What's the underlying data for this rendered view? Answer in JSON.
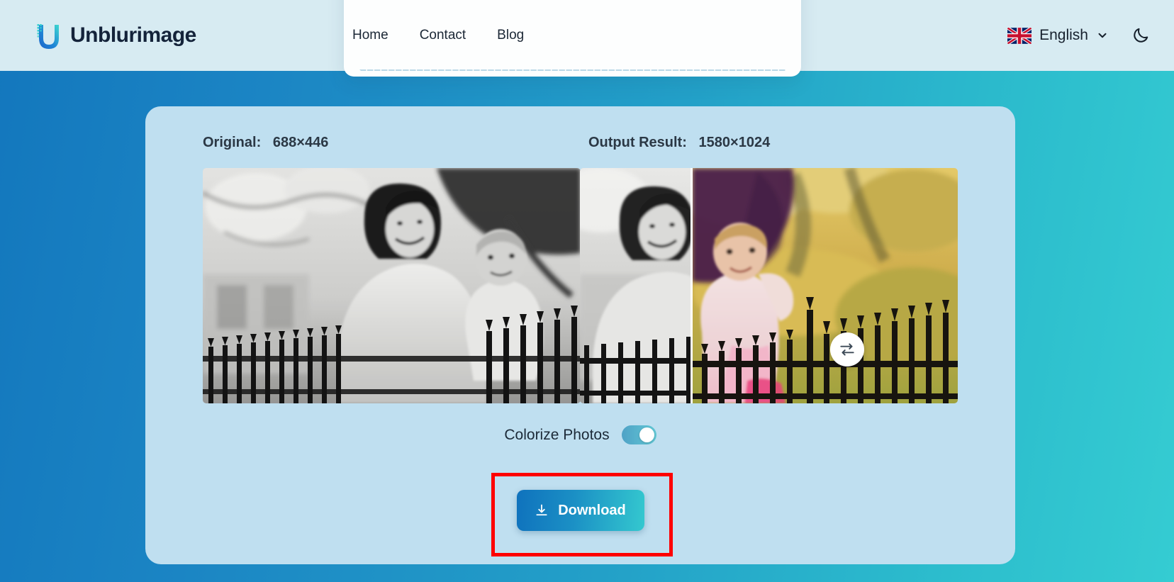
{
  "header": {
    "brand_name": "Unblurimage",
    "logo_icon": "unblurimage-u-logo",
    "nav": [
      {
        "label": "Home",
        "name": "nav-link-home"
      },
      {
        "label": "Contact",
        "name": "nav-link-contact"
      },
      {
        "label": "Blog",
        "name": "nav-link-blog"
      }
    ],
    "language": {
      "label": "English",
      "flag_icon": "uk-flag-icon",
      "chevron_icon": "chevron-down-icon"
    },
    "theme_toggle": {
      "icon": "moon-icon"
    }
  },
  "result_card": {
    "original_label": "Original:",
    "original_size": "688×446",
    "output_label": "Output Result:",
    "output_size": "1580×1024",
    "swap_icon": "swap-arrows-icon",
    "colorize": {
      "label": "Colorize Photos",
      "state": "on"
    },
    "download": {
      "label": "Download",
      "icon": "download-icon"
    }
  },
  "colors": {
    "background_left": "#1377bd",
    "background_right": "#35ccd2",
    "header_bg": "#d7ebf2",
    "card_bg": "#bfdff0",
    "accent_blue": "#0f72bd",
    "accent_teal": "#34c8cf",
    "annotation_red": "#fe0000",
    "text_dark": "#1c2a38"
  },
  "annotation": {
    "type": "highlight-rectangle",
    "target": "download-button"
  }
}
